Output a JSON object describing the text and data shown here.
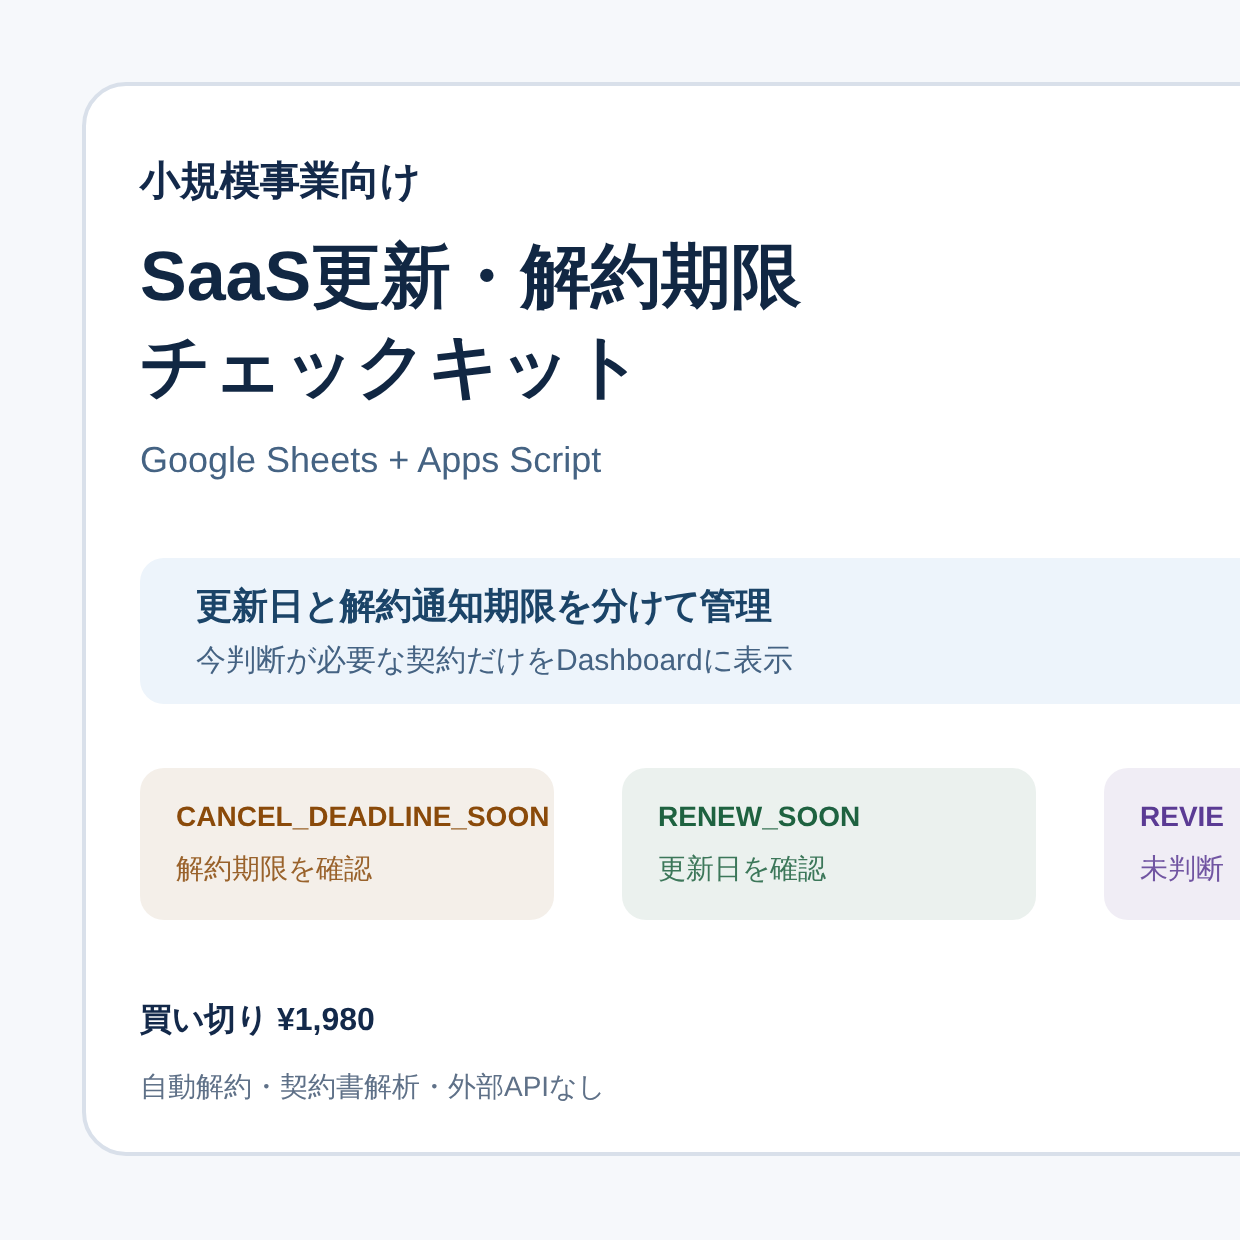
{
  "eyebrow": "小規模事業向け",
  "title_lines": [
    "SaaS更新・解約期限",
    "チェックキット"
  ],
  "subtitle": "Google Sheets + Apps Script",
  "banner": {
    "heading": "更新日と解約通知期限を分けて管理",
    "text": "今判断が必要な契約だけをDashboardに表示"
  },
  "statuses": [
    {
      "label": "CANCEL_DEADLINE_SOON",
      "description": "解約期限を確認",
      "color": "#8a4a0a"
    },
    {
      "label": "RENEW_SOON",
      "description": "更新日を確認",
      "color": "#1e6240"
    },
    {
      "label": "REVIE",
      "description": "未判断",
      "color": "#5b3b94"
    }
  ],
  "price": "買い切り ¥1,980",
  "note": "自動解約・契約書解析・外部APIなし"
}
